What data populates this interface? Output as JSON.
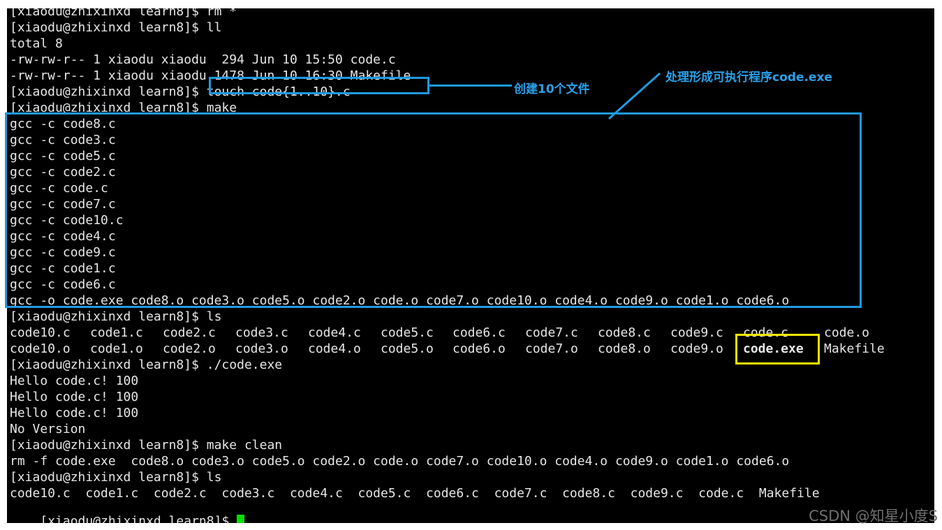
{
  "terminal": {
    "lines": [
      "[xiaodu@zhixinxd learn8]$ rm *",
      "[xiaodu@zhixinxd learn8]$ ll",
      "total 8",
      "-rw-rw-r-- 1 xiaodu xiaodu  294 Jun 10 15:50 code.c",
      "-rw-rw-r-- 1 xiaodu xiaodu 1478 Jun 10 16:30 Makefile",
      "[xiaodu@zhixinxd learn8]$ touch code{1..10}.c",
      "[xiaodu@zhixinxd learn8]$ make",
      "gcc -c code8.c",
      "gcc -c code3.c",
      "gcc -c code5.c",
      "gcc -c code2.c",
      "gcc -c code.c",
      "gcc -c code7.c",
      "gcc -c code10.c",
      "gcc -c code4.c",
      "gcc -c code9.c",
      "gcc -c code1.c",
      "gcc -c code6.c",
      "gcc -o code.exe code8.o code3.o code5.o code2.o code.o code7.o code10.o code4.o code9.o code1.o code6.o",
      "[xiaodu@zhixinxd learn8]$ ls"
    ],
    "ls1_row1": [
      "code10.c",
      "code1.c",
      "code2.c",
      "code3.c",
      "code4.c",
      "code5.c",
      "code6.c",
      "code7.c",
      "code8.c",
      "code9.c",
      "code.c",
      "code.o"
    ],
    "ls1_row2": [
      "code10.o",
      "code1.o",
      "code2.o",
      "code3.o",
      "code4.o",
      "code5.o",
      "code6.o",
      "code7.o",
      "code8.o",
      "code9.o",
      "code.exe",
      "Makefile"
    ],
    "lines2": [
      "[xiaodu@zhixinxd learn8]$ ./code.exe",
      "Hello code.c! 100",
      "Hello code.c! 100",
      "Hello code.c! 100",
      "No Version",
      "[xiaodu@zhixinxd learn8]$ make clean",
      "rm -f code.exe  code8.o code3.o code5.o code2.o code.o code7.o code10.o code4.o code9.o code1.o code6.o",
      "[xiaodu@zhixinxd learn8]$ ls",
      "code10.c  code1.c  code2.c  code3.c  code4.c  code5.c  code6.c  code7.c  code8.c  code9.c  code.c  Makefile"
    ],
    "prompt": "[xiaodu@zhixinxd learn8]$ "
  },
  "annotations": {
    "touch_note": "创建10个文件",
    "make_note": "处理形成可执行程序code.exe"
  },
  "colors": {
    "annotation_blue": "#1f9ae0",
    "highlight_yellow": "#f2e600",
    "exe_green": "#3ee23e",
    "cursor_green": "#00e000"
  },
  "watermark": "CSDN @知星小度S"
}
